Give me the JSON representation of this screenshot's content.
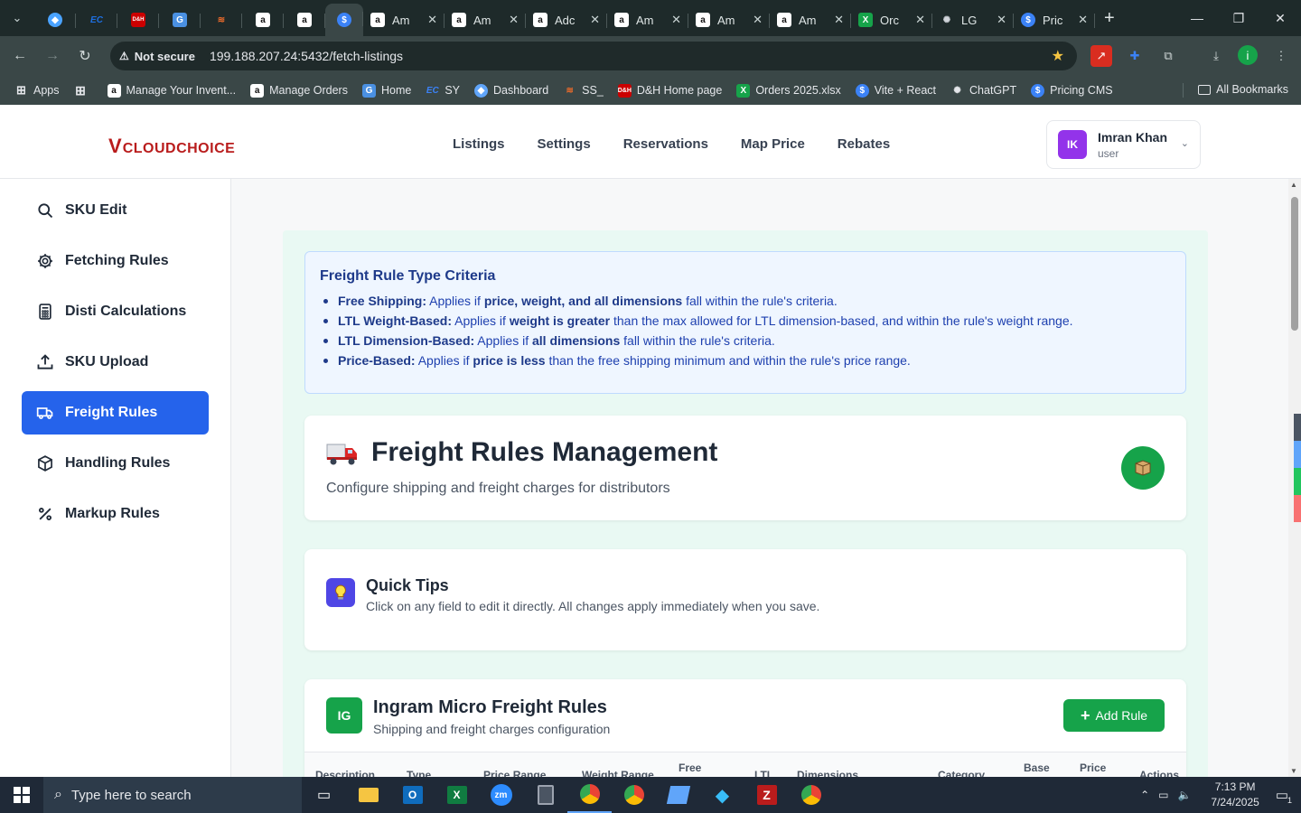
{
  "browser": {
    "tabs": [
      {
        "title": "",
        "icon": "color-icon",
        "color": "#4aa3ff"
      },
      {
        "title": "",
        "icon": "ec-icon",
        "color": "#1d6fe0"
      },
      {
        "title": "",
        "icon": "dh-icon",
        "color": "#c00"
      },
      {
        "title": "",
        "icon": "google-docs-icon",
        "color": "#4a90e2"
      },
      {
        "title": "",
        "icon": "stack-icon",
        "color": "#e86a2b"
      },
      {
        "title": "",
        "icon": "amazon-icon",
        "color": "#ffffff"
      },
      {
        "title": "",
        "icon": "amazon-icon",
        "color": "#ffffff"
      },
      {
        "title": "",
        "icon": "pricing-icon",
        "color": "#3b82f6"
      },
      {
        "title": "Am",
        "icon": "amazon-icon",
        "color": "#ffffff"
      },
      {
        "title": "Am",
        "icon": "amazon-icon",
        "color": "#ffffff"
      },
      {
        "title": "Adc",
        "icon": "amazon-icon",
        "color": "#ffffff"
      },
      {
        "title": "Am",
        "icon": "amazon-icon",
        "color": "#ffffff"
      },
      {
        "title": "Am",
        "icon": "amazon-icon",
        "color": "#ffffff"
      },
      {
        "title": "Am",
        "icon": "amazon-icon",
        "color": "#ffffff"
      },
      {
        "title": "Orc",
        "icon": "excel-icon",
        "color": "#16a34a"
      },
      {
        "title": "LG",
        "icon": "openai-icon",
        "color": "#d1d5db"
      },
      {
        "title": "Pric",
        "icon": "pricing-icon",
        "color": "#3b82f6"
      }
    ],
    "not_secure": "Not secure",
    "url": "199.188.207.24:5432/fetch-listings",
    "bookmarks": [
      {
        "label": "Apps"
      },
      {
        "label": "Manage Your Invent..."
      },
      {
        "label": "Manage Orders"
      },
      {
        "label": "Home"
      },
      {
        "label": "SY"
      },
      {
        "label": "Dashboard"
      },
      {
        "label": "SS_"
      },
      {
        "label": "D&H Home page"
      },
      {
        "label": "Orders 2025.xlsx"
      },
      {
        "label": "Vite + React"
      },
      {
        "label": "ChatGPT"
      },
      {
        "label": "Pricing CMS"
      }
    ],
    "all_bookmarks": "All Bookmarks"
  },
  "header": {
    "logo": "CLOUDCHOICE",
    "logo_mark": "V",
    "nav": [
      "Listings",
      "Settings",
      "Reservations",
      "Map Price",
      "Rebates"
    ],
    "user": {
      "initials": "IK",
      "name": "Imran Khan",
      "role": "user"
    }
  },
  "sidebar": {
    "items": [
      {
        "label": "SKU Edit",
        "icon": "search-icon"
      },
      {
        "label": "Fetching Rules",
        "icon": "gear-icon"
      },
      {
        "label": "Disti Calculations",
        "icon": "calculator-icon"
      },
      {
        "label": "SKU Upload",
        "icon": "upload-icon"
      },
      {
        "label": "Freight Rules",
        "icon": "truck-icon",
        "active": true
      },
      {
        "label": "Handling Rules",
        "icon": "box-icon"
      },
      {
        "label": "Markup Rules",
        "icon": "percent-icon"
      }
    ]
  },
  "criteria": {
    "title": "Freight Rule Type Criteria",
    "items": [
      {
        "name": "Free Shipping:",
        "p1": "Applies if ",
        "b1": "price, weight, and all dimensions",
        "p2": " fall within the rule's criteria."
      },
      {
        "name": "LTL Weight-Based:",
        "p1": "Applies if ",
        "b1": "weight is greater",
        "p2": " than the max allowed for LTL dimension-based, and within the rule's weight range."
      },
      {
        "name": "LTL Dimension-Based:",
        "p1": "Applies if ",
        "b1": "all dimensions",
        "p2": " fall within the rule's criteria."
      },
      {
        "name": "Price-Based:",
        "p1": "Applies if ",
        "b1": "price is less",
        "p2": " than the free shipping minimum and within the rule's price range."
      }
    ]
  },
  "management": {
    "title": "Freight Rules Management",
    "subtitle": "Configure shipping and freight charges for distributors"
  },
  "tips": {
    "title": "Quick Tips",
    "text": "Click on any field to edit it directly. All changes apply immediately when you save."
  },
  "ingram": {
    "badge": "IG",
    "title": "Ingram Micro Freight Rules",
    "subtitle": "Shipping and freight charges configuration",
    "add_label": "Add Rule",
    "columns": [
      "Description",
      "Type",
      "Price Range",
      "Weight Range",
      "Free",
      "LTL",
      "Dimensions",
      "Category",
      "Base",
      "Price",
      "Actions"
    ]
  },
  "taskbar": {
    "search_placeholder": "Type here to search",
    "time": "7:13 PM",
    "date": "7/24/2025",
    "notifications": "1"
  },
  "colors": {
    "accent": "#2563eb",
    "green": "#16a34a",
    "criteria_bg": "#eff6ff"
  }
}
